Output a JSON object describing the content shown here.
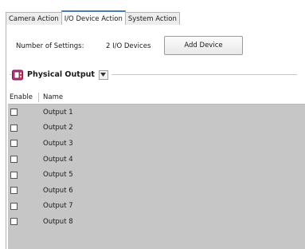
{
  "tabs": [
    {
      "label": "Camera Action",
      "active": false
    },
    {
      "label": "I/O Device Action",
      "active": true
    },
    {
      "label": "System Action",
      "active": false
    }
  ],
  "settings": {
    "label": "Number of Settings:",
    "value": "2 I/O Devices",
    "add_button": "Add Device"
  },
  "device_selector": {
    "label": "Physical Output",
    "icon": "io-device-icon",
    "dropdown_icon": "chevron-down-icon"
  },
  "table": {
    "columns": [
      "Enable",
      "Name"
    ],
    "rows": [
      {
        "enabled": false,
        "name": "Output 1"
      },
      {
        "enabled": false,
        "name": "Output 2"
      },
      {
        "enabled": false,
        "name": "Output 3"
      },
      {
        "enabled": false,
        "name": "Output 4"
      },
      {
        "enabled": false,
        "name": "Output 5"
      },
      {
        "enabled": false,
        "name": "Output 6"
      },
      {
        "enabled": false,
        "name": "Output 7"
      },
      {
        "enabled": false,
        "name": "Output 8"
      }
    ]
  },
  "colors": {
    "table_background": "#c6c6c6",
    "active_tab_accent": "#4a7ab8",
    "device_icon": "#d42a8c"
  }
}
